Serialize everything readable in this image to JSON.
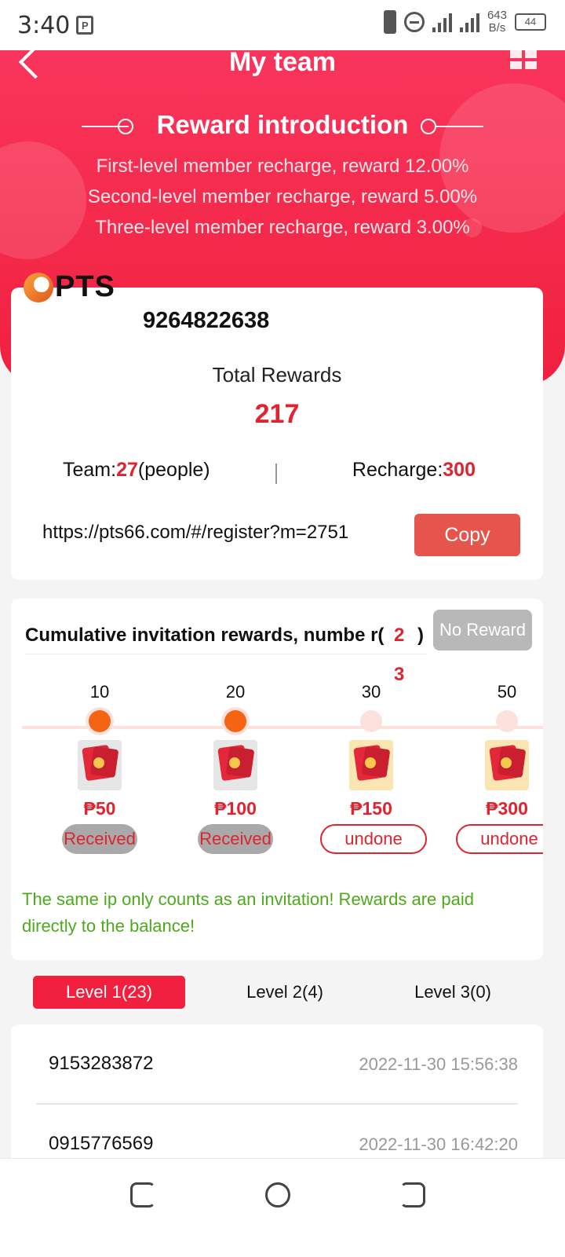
{
  "status_bar": {
    "time": "3:40",
    "net_speed_value": "643",
    "net_speed_unit": "B/s",
    "network_type": "4G",
    "battery": "44"
  },
  "nav": {
    "title": "My team"
  },
  "reward_intro": {
    "title": "Reward introduction",
    "lines": [
      "First-level member recharge, reward 12.00%",
      "Second-level member recharge, reward 5.00%",
      "Three-level member recharge, reward 3.00%"
    ]
  },
  "account": {
    "logo_text": "PTS",
    "phone": "9264822638",
    "total_rewards_label": "Total Rewards",
    "total_rewards_value": "217",
    "team_label": "Team:",
    "team_count": "27",
    "team_unit": "(people)",
    "recharge_label": "Recharge:",
    "recharge_value": "300",
    "invite_link": "https://pts66.com/#/register?m=2751",
    "copy_label": "Copy"
  },
  "invitation": {
    "title": "Cumulative invitation rewards, numbe r(",
    "count": "2 3",
    "close_paren": ")",
    "no_reward_label": "No Reward",
    "milestones": [
      {
        "threshold": "10",
        "amount": "₱50",
        "status": "Received",
        "done": true
      },
      {
        "threshold": "20",
        "amount": "₱100",
        "status": "Received",
        "done": true
      },
      {
        "threshold": "30",
        "amount": "₱150",
        "status": "undone",
        "done": false
      },
      {
        "threshold": "50",
        "amount": "₱300",
        "status": "undone",
        "done": false
      }
    ],
    "note": "The same ip only counts as an invitation! Rewards are paid directly to the balance!"
  },
  "tabs": [
    {
      "label": "Level 1(23)",
      "active": true
    },
    {
      "label": "Level 2(4)",
      "active": false
    },
    {
      "label": "Level 3(0)",
      "active": false
    }
  ],
  "members": [
    {
      "id": "9153283872",
      "time": "2022-11-30 15:56:38"
    },
    {
      "id": "0915776569",
      "time": "2022-11-30 16:42:20"
    }
  ],
  "colors": {
    "brand_red": "#f0203e",
    "accent_orange": "#f56412",
    "copy_button": "#e5554c",
    "note_green": "#4caa1b"
  },
  "icons": [
    "back-arrow-icon",
    "qr-code-icon",
    "envelope-icon",
    "recent-apps-icon",
    "home-icon",
    "back-icon"
  ]
}
